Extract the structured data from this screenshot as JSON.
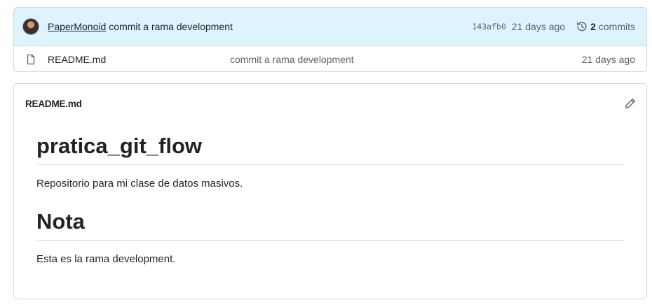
{
  "latest_commit": {
    "author": "PaperMonoid",
    "message": "commit a rama development",
    "sha": "143afb0",
    "age": "21 days ago",
    "commits_count": "2",
    "commits_label": "commits"
  },
  "files": [
    {
      "name": "README.md",
      "commit_message": "commit a rama development",
      "age": "21 days ago"
    }
  ],
  "readme": {
    "filename": "README.md",
    "h1_title": "pratica_git_flow",
    "description": "Repositorio para mi clase de datos masivos.",
    "h1_section": "Nota",
    "section_text": "Esta es la rama development."
  },
  "icons": {
    "avatar": "avatar",
    "history": "history-icon",
    "file": "file-icon",
    "edit": "pencil-icon"
  },
  "colors": {
    "commit_bar_bg": "#ddf4ff",
    "border": "#d0d7de",
    "text": "#1f2328",
    "muted": "#59636e"
  }
}
